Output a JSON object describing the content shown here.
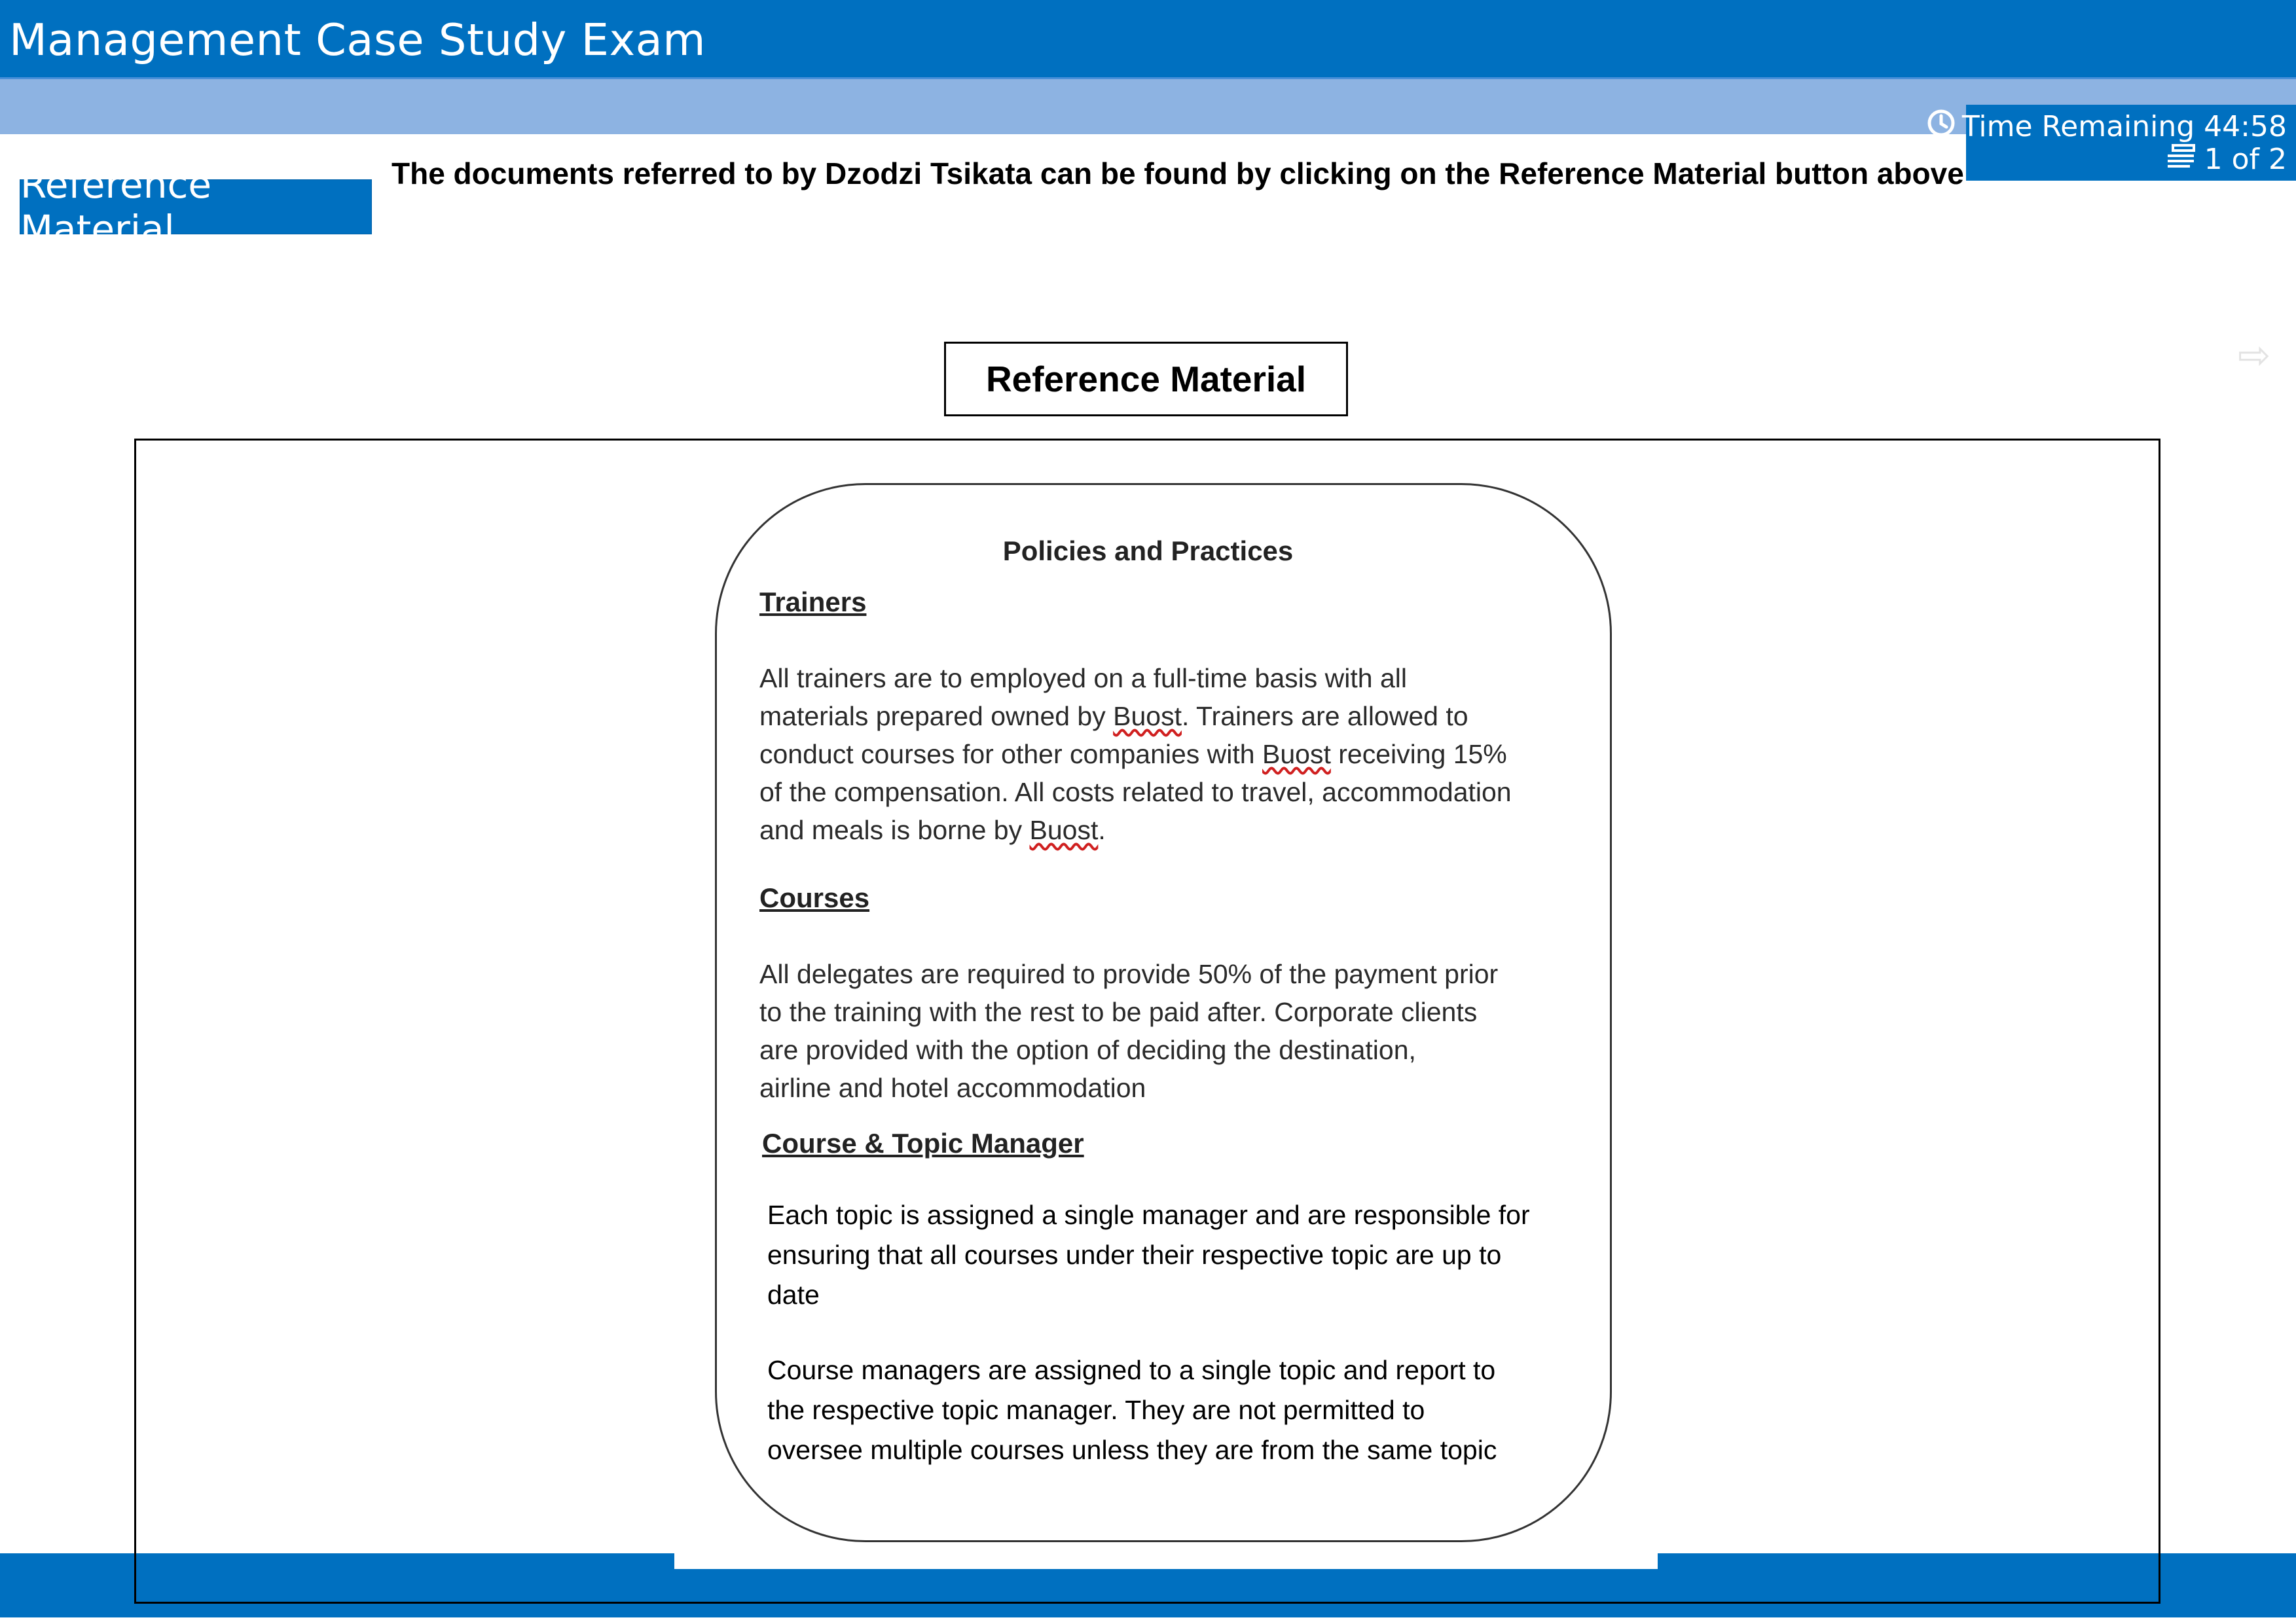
{
  "app": {
    "title": "Management Case Study Exam"
  },
  "status": {
    "time_label": "Time Remaining 44:58",
    "page_label": "1 of 2"
  },
  "toolbar": {
    "reference_button": "Reference Material"
  },
  "instruction": "The documents referred to by Dzodzi Tsikata can be found by clicking on the Reference Material button above",
  "icons": {
    "clock": "clock-icon",
    "pages": "pages-icon",
    "next": "next-arrow-icon"
  },
  "content": {
    "title": "Reference Material",
    "card_title": "Policies and Practices",
    "sections": [
      {
        "heading": "Trainers",
        "lines": [
          "All trainers are to employed on a full-time basis with all",
          [
            "materials prepared owned by ",
            "Buost",
            ". Trainers are allowed to"
          ],
          [
            "conduct courses for other companies with ",
            "Buost",
            " receiving 15%"
          ],
          "of the compensation. All costs related to travel, accommodation",
          [
            "and meals is borne by ",
            "Buost",
            "."
          ]
        ]
      },
      {
        "heading": "Courses",
        "lines": [
          "All delegates are required to provide 50% of the payment prior",
          "to the training with the rest to be paid after. Corporate clients",
          "are provided with the option of deciding the destination,",
          "airline and hotel accommodation"
        ]
      },
      {
        "heading": "Course & Topic Manager",
        "paragraphs": [
          [
            "Each topic is assigned a single manager and are responsible for",
            "ensuring that all courses under their respective topic are up to",
            "date"
          ],
          [
            "Course managers are assigned to a single topic and report to",
            "the respective topic manager. They are not permitted to",
            "oversee multiple courses unless they are from the same topic"
          ]
        ]
      }
    ]
  },
  "colors": {
    "primary": "#0070c0",
    "subbar": "#8db3e2",
    "spell_underline": "#d02020"
  }
}
